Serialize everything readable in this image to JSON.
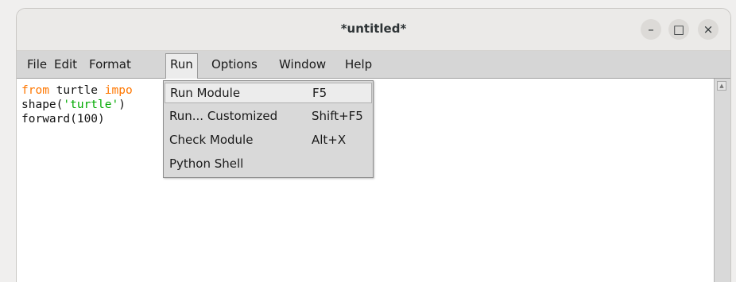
{
  "window": {
    "title": "*untitled*",
    "controls": {
      "minimize": "–",
      "maximize": "□",
      "close": "×"
    }
  },
  "menubar": {
    "items": [
      "File",
      "Edit",
      "Format",
      "Run",
      "Options",
      "Window",
      "Help"
    ],
    "active": "Run"
  },
  "editor": {
    "line1": {
      "kw_from": "from",
      "mid": " turtle ",
      "kw_import": "impo"
    },
    "line2": {
      "pre": "shape(",
      "str": "'turtle'",
      "post": ")"
    },
    "line3": "forward(100)"
  },
  "run_menu": {
    "items": [
      {
        "label": "Run Module",
        "accel": "F5"
      },
      {
        "label": "Run... Customized",
        "accel": "Shift+F5"
      },
      {
        "label": "Check Module",
        "accel": "Alt+X"
      },
      {
        "label": "Python Shell",
        "accel": ""
      }
    ]
  },
  "colors": {
    "keyword": "#ff7700",
    "string": "#00aa00"
  }
}
